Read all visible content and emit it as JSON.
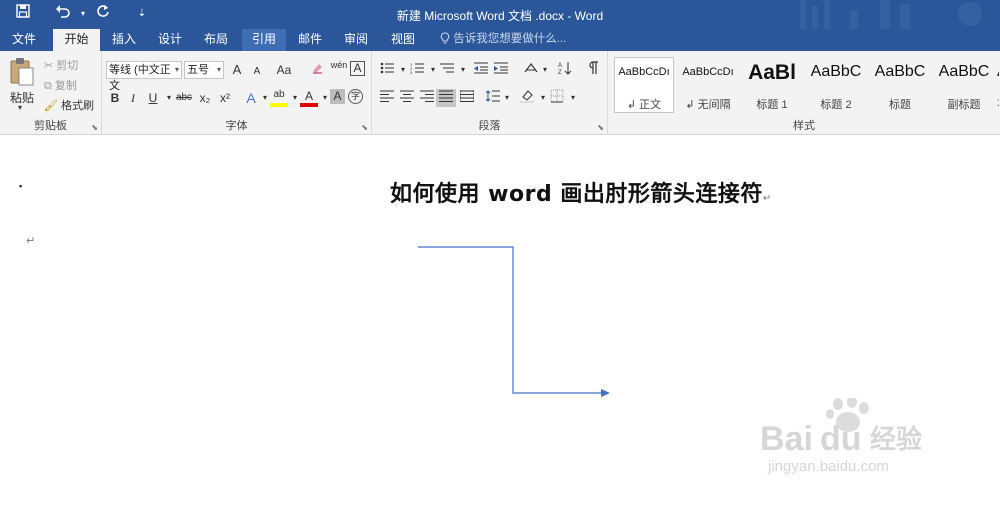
{
  "titlebar": {
    "title": "新建 Microsoft Word 文档 .docx - Word",
    "save_icon": "save-icon",
    "undo_icon": "undo-icon",
    "redo_icon": "redo-icon",
    "customize_icon": "customize-qat-icon"
  },
  "tabs": [
    {
      "label": "文件"
    },
    {
      "label": "开始"
    },
    {
      "label": "插入"
    },
    {
      "label": "设计"
    },
    {
      "label": "布局"
    },
    {
      "label": "引用"
    },
    {
      "label": "邮件"
    },
    {
      "label": "审阅"
    },
    {
      "label": "视图"
    }
  ],
  "tellme": {
    "placeholder": "告诉我您想要做什么..."
  },
  "clipboard": {
    "paste_label": "粘贴",
    "cut_label": "剪切",
    "copy_label": "复制",
    "format_painter_label": "格式刷",
    "group_label": "剪贴板"
  },
  "font": {
    "font_name": "等线 (中文正文",
    "font_size": "五号",
    "grow_label": "A",
    "shrink_label": "A",
    "case_label": "Aa",
    "phonetic_label": "wén",
    "border_char_label": "A",
    "bold_label": "B",
    "italic_label": "I",
    "underline_label": "U",
    "strike_label": "abc",
    "sub_label": "x₂",
    "sup_label": "x²",
    "effects_label": "A",
    "highlight_label": "ab",
    "color_label": "A",
    "shading_label": "A",
    "enclose_label": "字",
    "group_label": "字体"
  },
  "paragraph": {
    "group_label": "段落"
  },
  "styles": {
    "group_label": "样式",
    "items": [
      {
        "preview": "AaBbCcDı",
        "name": "↲ 正文",
        "size": "11"
      },
      {
        "preview": "AaBbCcDı",
        "name": "↲ 无间隔",
        "size": "11"
      },
      {
        "preview": "AaBl",
        "name": "标题 1",
        "size": "21"
      },
      {
        "preview": "AaBbC",
        "name": "标题 2",
        "size": "16"
      },
      {
        "preview": "AaBbC",
        "name": "标题",
        "size": "16"
      },
      {
        "preview": "AaBbC",
        "name": "副标题",
        "size": "16"
      },
      {
        "preview": "A",
        "name": "不",
        "size": "16"
      }
    ]
  },
  "document": {
    "heading": "如何使用 word 画出肘形箭头连接符",
    "paragraph_mark": "↵",
    "bullet": "▪",
    "connector_color": "#4472c4"
  },
  "watermark": {
    "brand": "Baidu",
    "suffix": "经验",
    "url": "jingyan.baidu.com"
  },
  "colors": {
    "accent": "#2b579a",
    "ribbon_bg": "#f3f3f3",
    "highlight_yellow": "#ffff00",
    "font_red": "#e00000"
  }
}
